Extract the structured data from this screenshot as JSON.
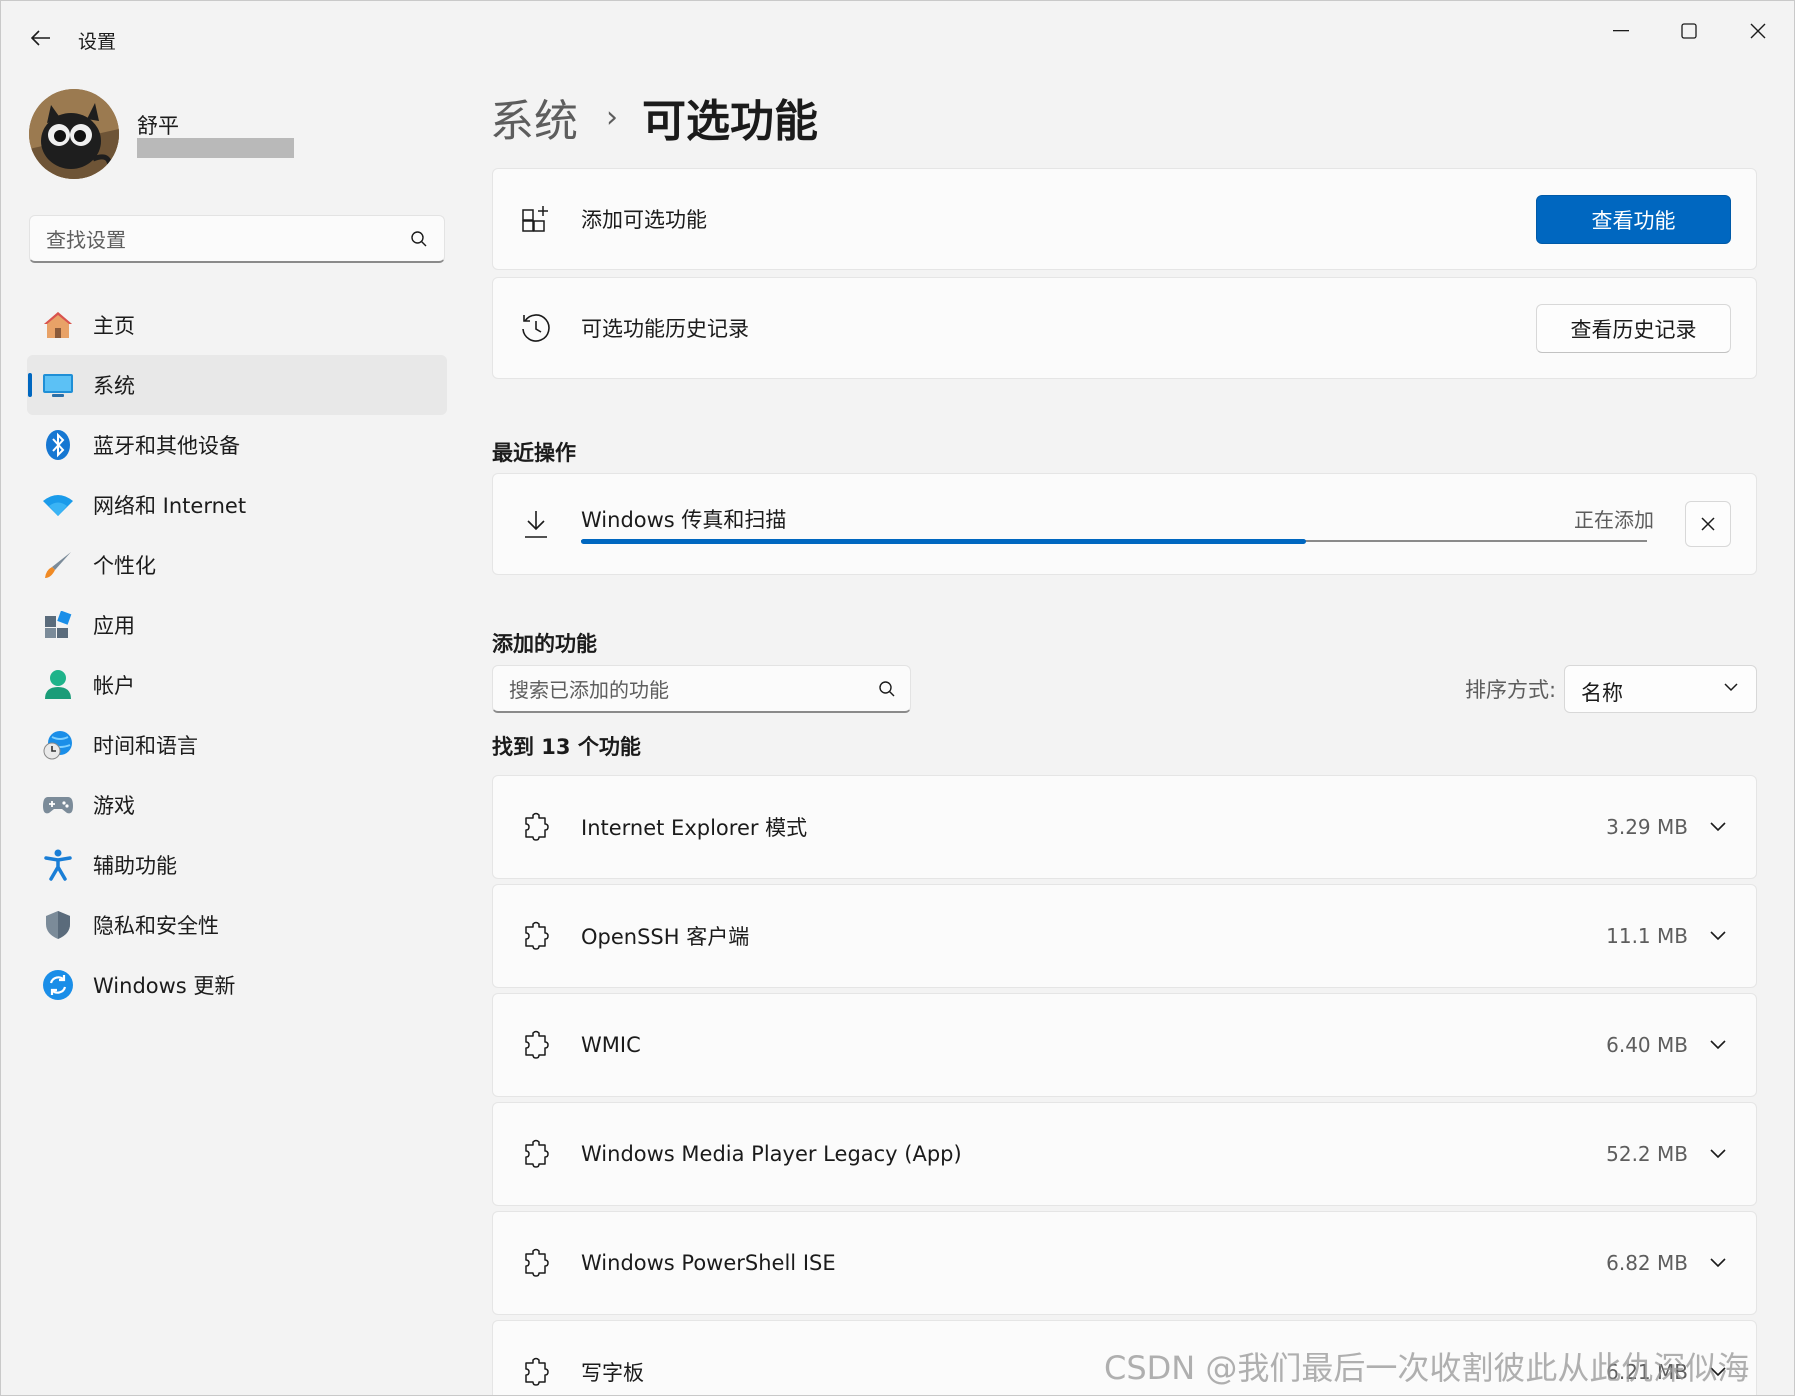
{
  "window": {
    "title": "设置",
    "icons": {
      "back": "arrow-left-icon",
      "minimize": "minimize-icon",
      "maximize": "maximize-icon",
      "close": "close-icon"
    }
  },
  "user": {
    "name": "舒平",
    "email_redacted": true
  },
  "sidebar": {
    "search_placeholder": "查找设置",
    "items": [
      {
        "label": "主页",
        "icon": "home-icon",
        "active": false
      },
      {
        "label": "系统",
        "icon": "system-icon",
        "active": true
      },
      {
        "label": "蓝牙和其他设备",
        "icon": "bluetooth-icon",
        "active": false
      },
      {
        "label": "网络和 Internet",
        "icon": "wifi-icon",
        "active": false
      },
      {
        "label": "个性化",
        "icon": "brush-icon",
        "active": false
      },
      {
        "label": "应用",
        "icon": "apps-icon",
        "active": false
      },
      {
        "label": "帐户",
        "icon": "account-icon",
        "active": false
      },
      {
        "label": "时间和语言",
        "icon": "time-language-icon",
        "active": false
      },
      {
        "label": "游戏",
        "icon": "gaming-icon",
        "active": false
      },
      {
        "label": "辅助功能",
        "icon": "accessibility-icon",
        "active": false
      },
      {
        "label": "隐私和安全性",
        "icon": "shield-icon",
        "active": false
      },
      {
        "label": "Windows 更新",
        "icon": "windows-update-icon",
        "active": false
      }
    ]
  },
  "breadcrumb": {
    "parent": "系统",
    "separator": "›",
    "current": "可选功能"
  },
  "add_feature": {
    "label": "添加可选功能",
    "button": "查看功能",
    "icon": "add-apps-icon"
  },
  "history": {
    "label": "可选功能历史记录",
    "button": "查看历史记录",
    "icon": "history-icon"
  },
  "recent": {
    "title": "最近操作",
    "item": {
      "label": "Windows 传真和扫描",
      "status": "正在添加",
      "progress": 0.68,
      "icon": "download-icon"
    }
  },
  "added": {
    "title": "添加的功能",
    "search_placeholder": "搜索已添加的功能",
    "sort_label": "排序方式:",
    "sort_value": "名称",
    "found_text": "找到 13 个功能",
    "features": [
      {
        "name": "Internet Explorer 模式",
        "size": "3.29 MB"
      },
      {
        "name": "OpenSSH 客户端",
        "size": "11.1 MB"
      },
      {
        "name": "WMIC",
        "size": "6.40 MB"
      },
      {
        "name": "Windows Media Player Legacy (App)",
        "size": "52.2 MB"
      },
      {
        "name": "Windows PowerShell ISE",
        "size": "6.82 MB"
      },
      {
        "name": "写字板",
        "size": "6.21 MB"
      }
    ]
  },
  "watermark": "CSDN @我们最后一次收割彼此从此仇深似海",
  "colors": {
    "accent": "#0067c0",
    "background": "#f3f3f3",
    "card": "#fbfbfb"
  }
}
